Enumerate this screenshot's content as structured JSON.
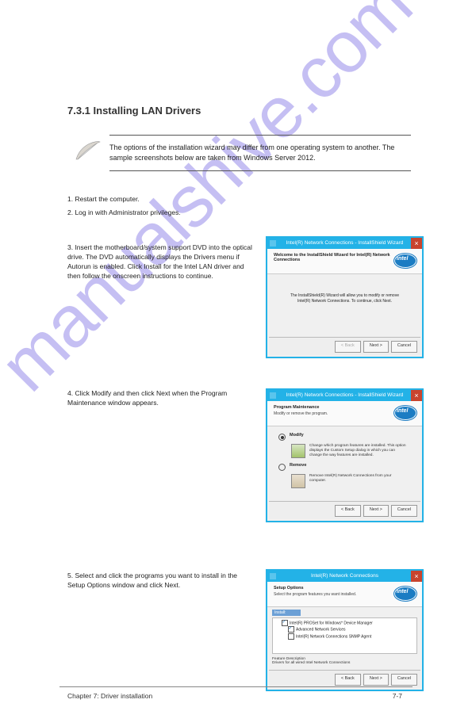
{
  "watermark": "manualshive.com",
  "heading": "7.3.1  Installing LAN Drivers",
  "note": "The options of the installation wizard may differ from one operating system to another. The sample screenshots below are taken from Windows Server 2012.",
  "steps": {
    "s1": "1.  Restart the computer.",
    "s2": "2.  Log in with Administrator privileges.",
    "s3": "3.  Insert the motherboard/system support DVD into the optical drive. The DVD automatically displays the Drivers menu if Autorun is enabled. Click Install for the Intel LAN driver and then follow the onscreen instructions to continue.",
    "s4": "4.  Click Modify and then click Next when the Program Maintenance window appears.",
    "s5": "5.  Select and click the programs you want to install in the Setup Options window and click Next."
  },
  "dlg1": {
    "title": "Intel(R) Network Connections - InstallShield Wizard",
    "headBold": "Welcome to the InstallShield Wizard for Intel(R) Network Connections",
    "body": "The InstallShield(R) Wizard will allow you to modify or remove Intel(R) Network Connections. To continue, click Next.",
    "brand": "InstallShield",
    "btnBack": "< Back",
    "btnNext": "Next >",
    "btnCancel": "Cancel"
  },
  "dlg2": {
    "title": "Intel(R) Network Connections - InstallShield Wizard",
    "headBold": "Program Maintenance",
    "headSub": "Modify or remove the program.",
    "optModify": "Modify",
    "optModifyDesc": "Change which program features are installed. This option displays the Custom Setup dialog in which you can change the way features are installed.",
    "optRemove": "Remove",
    "optRemoveDesc": "Remove Intel(R) Network Connections from your computer.",
    "brand": "InstallShield",
    "btnBack": "< Back",
    "btnNext": "Next >",
    "btnCancel": "Cancel"
  },
  "dlg3": {
    "title": "Intel(R) Network Connections",
    "headBold": "Setup Options",
    "headSub": "Select the program features you want installed.",
    "installLabel": "Install:",
    "tree": {
      "a": "Intel(R) PROSet for Windows* Device Manager",
      "b": "Advanced Network Services",
      "c": "Intel(R) Network Connections SNMP Agent"
    },
    "featTitle": "Feature Description",
    "featDesc": "Drivers for all wired Intel Network Connections",
    "btnBack": "< Back",
    "btnNext": "Next >",
    "btnCancel": "Cancel"
  },
  "footer": {
    "chapter": "Chapter 7: Driver installation",
    "page": "7-7"
  }
}
